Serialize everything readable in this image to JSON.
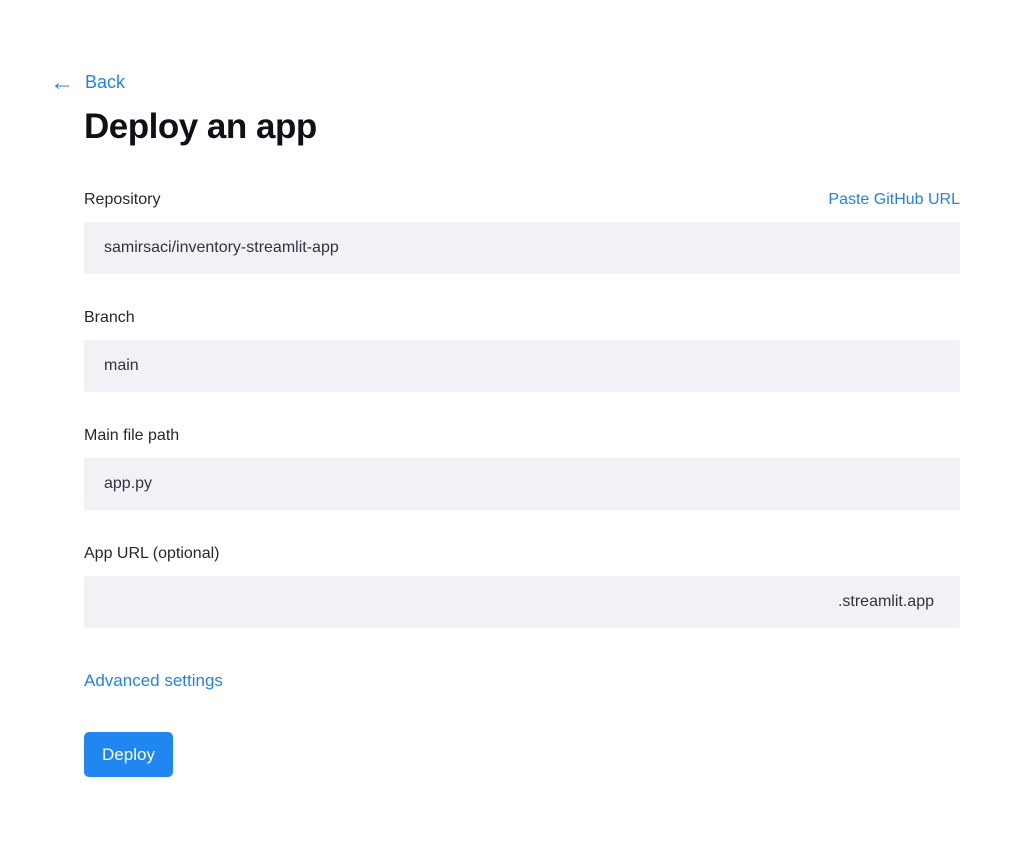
{
  "page": {
    "back_label": "Back",
    "back_arrow": "←",
    "title": "Deploy an app"
  },
  "form": {
    "repository": {
      "label": "Repository",
      "value": "samirsaci/inventory-streamlit-app",
      "action_link": "Paste GitHub URL"
    },
    "branch": {
      "label": "Branch",
      "value": "main"
    },
    "main_file_path": {
      "label": "Main file path",
      "value": "app.py"
    },
    "app_url": {
      "label": "App URL (optional)",
      "value": "",
      "suffix": ".streamlit.app"
    },
    "advanced_settings_label": "Advanced settings",
    "deploy_label": "Deploy"
  },
  "colors": {
    "accent_blue": "#2383e2",
    "button_blue": "#2086f0",
    "field_background": "#f0f2f6",
    "text_dark": "#31333f",
    "title_black": "#0e1117",
    "page_background": "#ffffff"
  }
}
